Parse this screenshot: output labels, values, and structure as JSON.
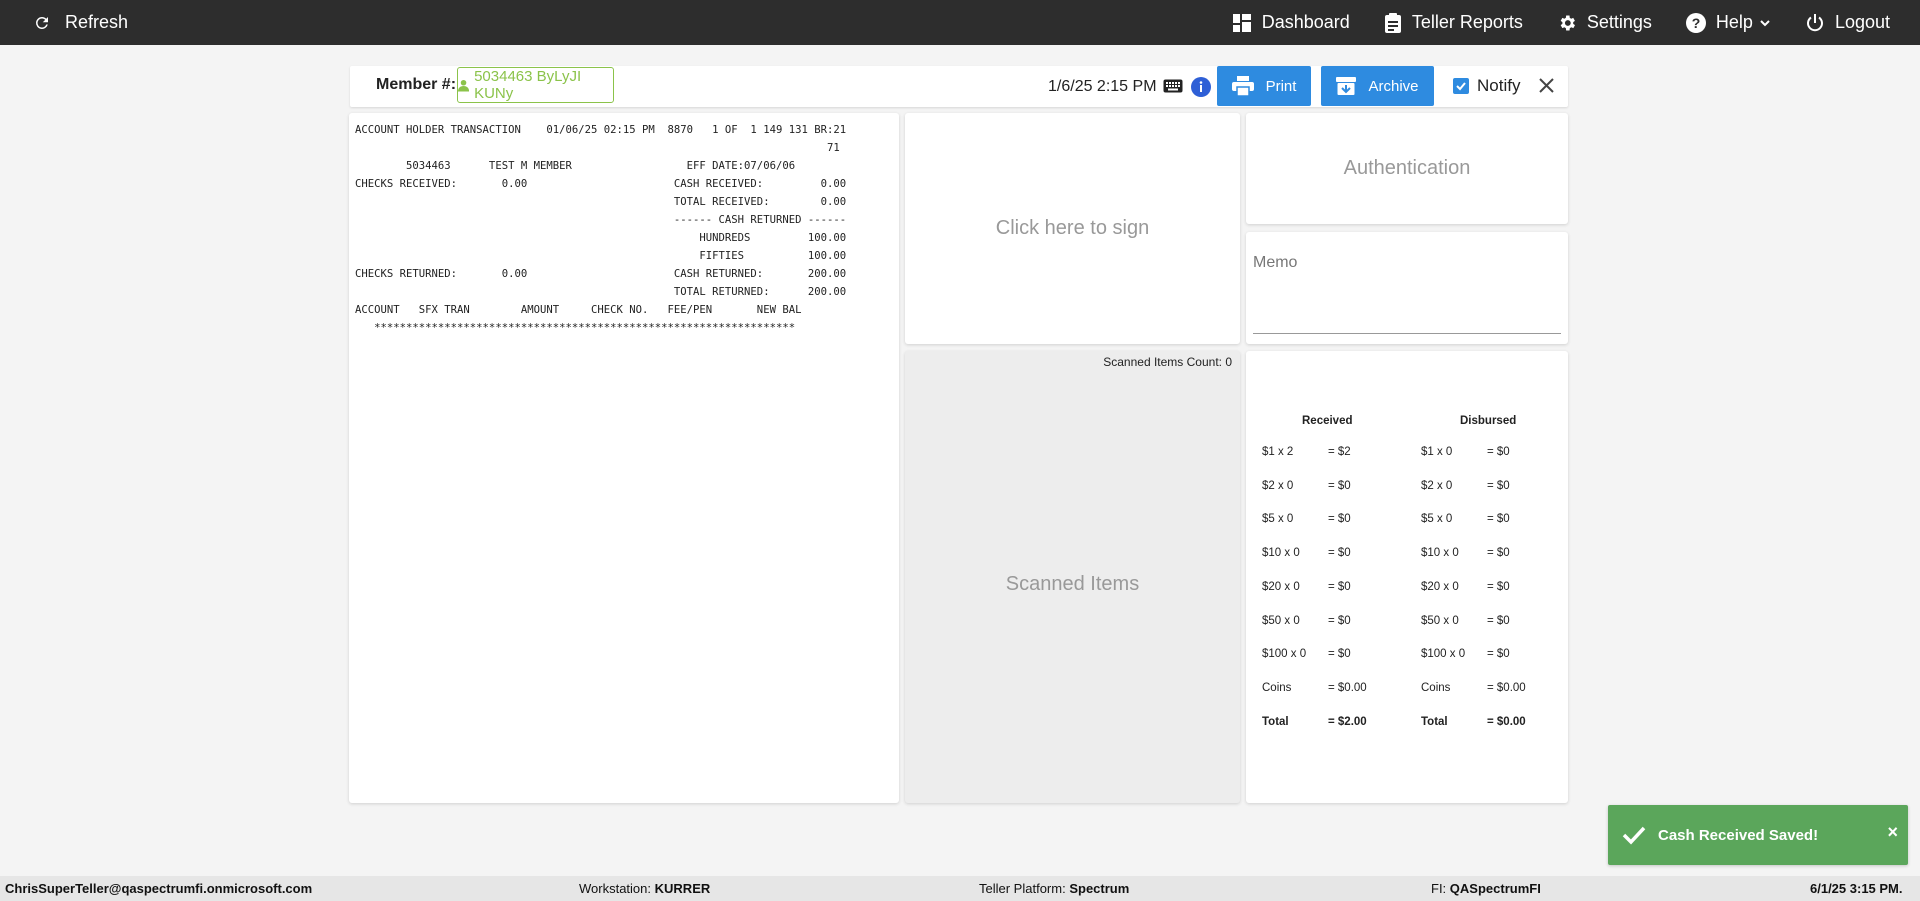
{
  "topbar": {
    "refresh_label": "Refresh",
    "nav": [
      {
        "label": "Dashboard",
        "icon": "dashboard-icon"
      },
      {
        "label": "Teller Reports",
        "icon": "clipboard-icon"
      },
      {
        "label": "Settings",
        "icon": "gear-icon"
      },
      {
        "label": "Help",
        "icon": "help-icon"
      },
      {
        "label": "Logout",
        "icon": "power-icon"
      }
    ]
  },
  "member": {
    "label": "Member #:",
    "value": "5034463 ByLyJI KUNy",
    "datetime": "1/6/25 2:15 PM",
    "print_label": "Print",
    "archive_label": "Archive",
    "notify_label": "Notify",
    "notify_checked": true
  },
  "receipt": {
    "text": "ACCOUNT HOLDER TRANSACTION    01/06/25 02:15 PM  8870   1 OF  1 149 131 BR:21\n                                                                          71\n        5034463      TEST M MEMBER                  EFF DATE:07/06/06\nCHECKS RECEIVED:       0.00                       CASH RECEIVED:         0.00\n                                                  TOTAL RECEIVED:        0.00\n                                                  ------ CASH RETURNED ------\n                                                      HUNDREDS         100.00\n                                                      FIFTIES          100.00\nCHECKS RETURNED:       0.00                       CASH RETURNED:       200.00\n                                                  TOTAL RETURNED:      200.00\nACCOUNT   SFX TRAN        AMOUNT     CHECK NO.   FEE/PEN       NEW BAL\n   ******************************************************************"
  },
  "sign": {
    "label": "Click here to sign"
  },
  "auth": {
    "label": "Authentication"
  },
  "memo": {
    "label": "Memo",
    "value": ""
  },
  "scanned": {
    "count_label": "Scanned Items Count: 0",
    "title": "Scanned Items"
  },
  "cash": {
    "received_header": "Received",
    "disbursed_header": "Disbursed",
    "rows": [
      {
        "rd": "$1 x 2",
        "rv": "= $2",
        "dd": "$1 x 0",
        "dv": "= $0",
        "bold": false
      },
      {
        "rd": "$2 x 0",
        "rv": "= $0",
        "dd": "$2 x 0",
        "dv": "= $0",
        "bold": false
      },
      {
        "rd": "$5 x 0",
        "rv": "= $0",
        "dd": "$5 x 0",
        "dv": "= $0",
        "bold": false
      },
      {
        "rd": "$10 x 0",
        "rv": "= $0",
        "dd": "$10 x 0",
        "dv": "= $0",
        "bold": false
      },
      {
        "rd": "$20 x 0",
        "rv": "= $0",
        "dd": "$20 x 0",
        "dv": "= $0",
        "bold": false
      },
      {
        "rd": "$50 x 0",
        "rv": "= $0",
        "dd": "$50 x 0",
        "dv": "= $0",
        "bold": false
      },
      {
        "rd": "$100 x 0",
        "rv": "= $0",
        "dd": "$100 x 0",
        "dv": "= $0",
        "bold": false
      },
      {
        "rd": "Coins",
        "rv": "= $0.00",
        "dd": "Coins",
        "dv": "= $0.00",
        "bold": false
      },
      {
        "rd": "Total",
        "rv": "= $2.00",
        "dd": "Total",
        "dv": "= $0.00",
        "bold": true
      }
    ]
  },
  "toast": {
    "message": "Cash Received Saved!",
    "close": "×"
  },
  "footer": {
    "user": "ChrisSuperTeller@qaspectrumfi.onmicrosoft.com",
    "workstation_label": "Workstation:",
    "workstation": "KURRER",
    "platform_label": "Teller Platform:",
    "platform": "Spectrum",
    "fi_label": "FI:",
    "fi": "QASpectrumFI",
    "datetime": "6/1/25 3:15 PM."
  },
  "colors": {
    "accent": "#2e8be0",
    "success": "#5ba65b",
    "member_chip": "#8bc34a",
    "topbar": "#2d2d2d"
  }
}
